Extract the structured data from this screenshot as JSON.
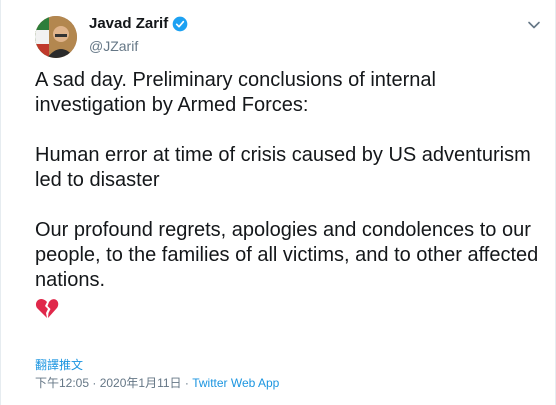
{
  "profile": {
    "display_name": "Javad Zarif",
    "handle": "@JZarif",
    "verified": true
  },
  "tweet": {
    "paragraphs": [
      "A sad day. Preliminary conclusions of internal investigation by Armed Forces:",
      "Human error at time of crisis caused by US adventurism led to disaster",
      "Our profound regrets, apologies and condolences to our people, to the families of all victims, and to other affected nations."
    ],
    "emoji": "broken-heart-icon"
  },
  "translate_label": "翻譯推文",
  "meta": {
    "time": "下午12:05",
    "separator": " · ",
    "date": "2020年1月11日",
    "source": "Twitter Web App"
  },
  "colors": {
    "link": "#1b95e0",
    "muted": "#657786",
    "text": "#14171a",
    "verified": "#1da1f2",
    "broken_heart": "#e0284a"
  }
}
